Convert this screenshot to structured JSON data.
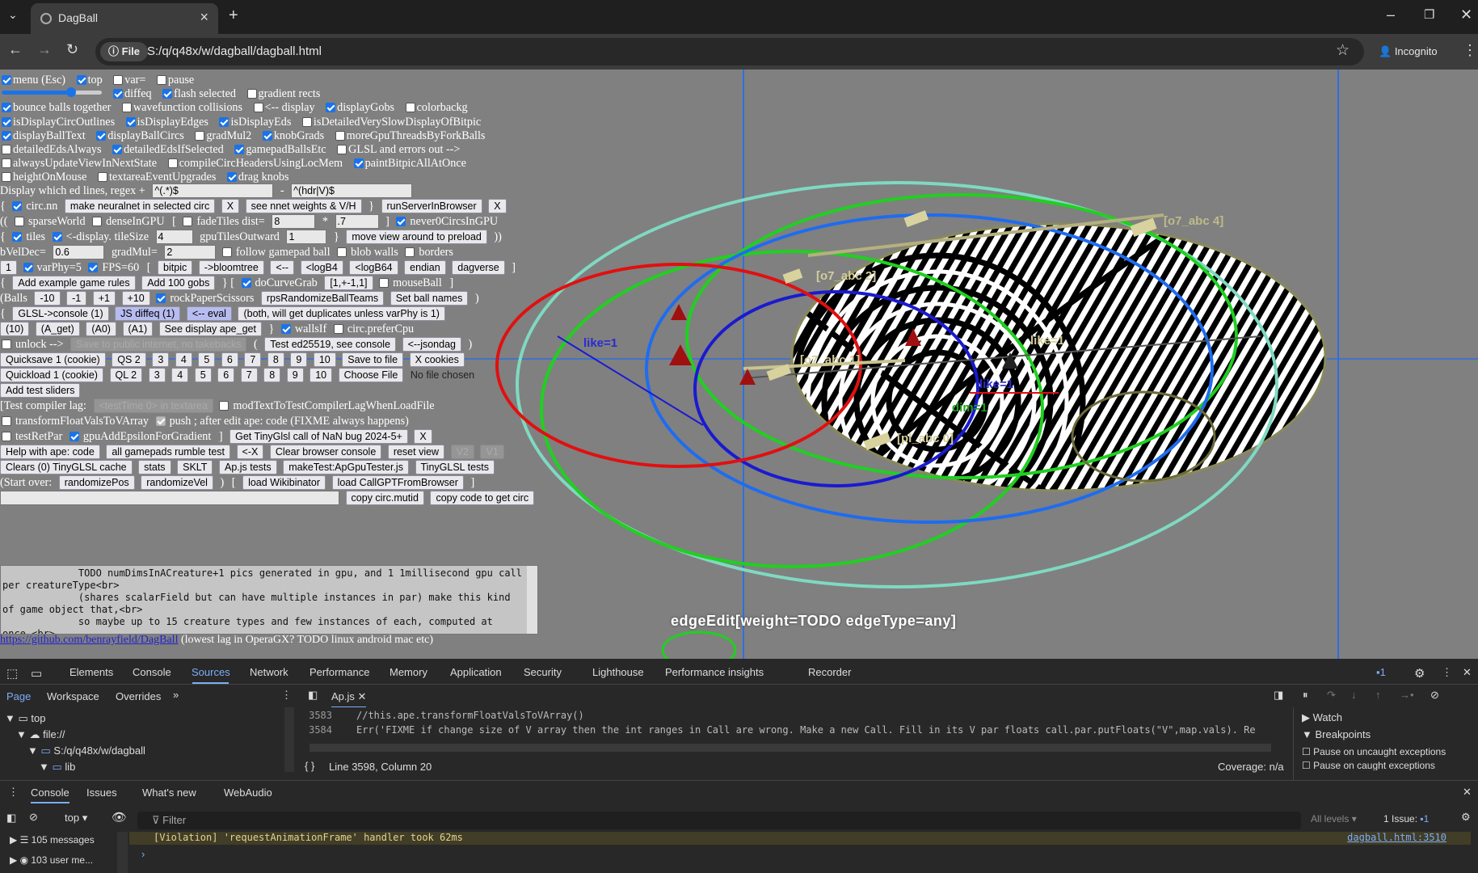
{
  "browser": {
    "tab_title": "DagBall",
    "url_chip": "File",
    "url": "S:/q/q48x/w/dagball/dagball.html",
    "incognito_label": "Incognito"
  },
  "panel": {
    "row0": {
      "menu": "menu (Esc)",
      "top": "top",
      "var": "var=",
      "pause": "pause"
    },
    "row1": {
      "diffeq": "diffeq",
      "flash": "flash selected",
      "gradient": "gradient rects"
    },
    "row2": {
      "bounce": "bounce balls together",
      "wavefn": "wavefunction collisions",
      "display": "<-- display",
      "gobs": "displayGobs",
      "colorbackg": "colorbackg"
    },
    "row3": {
      "circout": "isDisplayCircOutlines",
      "edges": "isDisplayEdges",
      "eds": "isDisplayEds",
      "detailed": "isDetailedVerySlowDisplayOfBitpic"
    },
    "row4": {
      "balltext": "displayBallText",
      "ballcircs": "displayBallCircs",
      "gradmul": "gradMul2",
      "knobgrads": "knobGrads",
      "moregpu": "moreGpuThreadsByForkBalls"
    },
    "row5": {
      "detEds": "detailedEdsAlways",
      "detEdsSel": "detailedEdsIfSelected",
      "gamepad": "gamepadBallsEtc",
      "glsl": "GLSL and errors out -->"
    },
    "row6": {
      "always": "alwaysUpdateViewInNextState",
      "compile": "compileCircHeadersUsingLocMem",
      "paint": "paintBitpicAllAtOnce"
    },
    "row7": {
      "height": "heightOnMouse",
      "textarea": "textareaEventUpgrades",
      "drag": "drag knobs"
    },
    "row8": {
      "label": "Display which ed lines, regex +",
      "regex_plus": "^(.*)$",
      "minus": "-",
      "regex_minus": "^(hdr|V)$"
    },
    "row9": {
      "open": "{",
      "circnn": "circ.nn",
      "b1": "make neuralnet in selected circ",
      "x1": "X",
      "b2": "see nnet weights & V/H",
      "close": "}",
      "b3": "runServerInBrowser",
      "x2": "X"
    },
    "row10": {
      "open": "((",
      "sparse": "sparseWorld",
      "dense": "denseInGPU",
      "bracket": "[",
      "fade": "fadeTiles dist=",
      "fade_val": "8",
      "star": "*",
      "fade_mul": ".7",
      "close": "]",
      "never0": "never0CircsInGPU"
    },
    "row11": {
      "open": "{",
      "tiles": "tiles",
      "display": "<-display. tileSize",
      "tilesize": "4",
      "outward": "gpuTilesOutward",
      "outward_val": "1",
      "close": "}",
      "move": "move view around to preload",
      "end": "))"
    },
    "row12": {
      "veldec": "bVelDec=",
      "veldec_val": "0.6",
      "gradmul": "gradMul=",
      "gradmul_val": "2",
      "follow": "follow gamepad ball",
      "blob": "blob walls",
      "borders": "borders"
    },
    "row13": {
      "one": "1",
      "varphy": "varPhy=5",
      "fps": "FPS=60",
      "bracket": "[",
      "bitpic": "bitpic",
      "bloom": "->bloomtree",
      "back": "<--",
      "logb4": "<logB4",
      "logb64": "<logB64",
      "endian": "endian",
      "dagverse": "dagverse",
      "close": "]"
    },
    "row14": {
      "open": "{",
      "addex": "Add example game rules",
      "add100": "Add 100 gobs",
      "mid": "} [",
      "curve": "doCurveGrab",
      "curve_btn": "[1,+-1,1]",
      "mouse": "mouseBall",
      "close": "]"
    },
    "row15": {
      "balls": "(Balls",
      "m10": "-10",
      "m1": "-1",
      "p1": "+1",
      "p10": "+10",
      "rps": "rockPaperScissors",
      "rpsbtn": "rpsRandomizeBallTeams",
      "names": "Set ball names",
      "close": ")"
    },
    "row16": {
      "open": "{",
      "glsl": "GLSL->console (1)",
      "js": "JS diffeq (1)",
      "eval": "<-- eval",
      "both": "(both, will get duplicates unless varPhy is 1)"
    },
    "row17": {
      "b10": "(10)",
      "aget": "(A_get)",
      "a0": "(A0)",
      "a1": "(A1)",
      "seeape": "See display ape_get",
      "close": "}",
      "walls": "wallsIf",
      "prefer": "circ.preferCpu"
    },
    "row18": {
      "unlock": "unlock -->",
      "save": "Save to public internet, no takebacks",
      "open": "(",
      "test": "Test ed25519, see console",
      "json": "<--jsondag",
      "close": ")"
    },
    "row19": {
      "qs1": "Quicksave 1 (cookie)",
      "qs2": "QS 2",
      "n": [
        "3",
        "4",
        "5",
        "6",
        "7",
        "8",
        "9",
        "10"
      ],
      "savefile": "Save to file",
      "xcookies": "X cookies"
    },
    "row20": {
      "ql1": "Quickload 1 (cookie)",
      "ql2": "QL 2",
      "n": [
        "3",
        "4",
        "5",
        "6",
        "7",
        "8",
        "9",
        "10"
      ],
      "choose": "Choose File",
      "nofile": "No file chosen"
    },
    "row21": {
      "sliders": "Add test sliders"
    },
    "row22": {
      "lag": "[Test compiler lag:",
      "testtime": "<testTime 0> in textarea",
      "mod": "modTextToTestCompilerLagWhenLoadFile"
    },
    "row23": {
      "transform": "transformFloatValsToVArray",
      "push": "push ; after edit ape: code (FIXME always happens)"
    },
    "row24": {
      "testret": "testRetPar",
      "gpuadd": "gpuAddEpsilonForGradient",
      "close": "]",
      "nanbug": "Get TinyGlsl call of NaN bug 2024-5+",
      "x": "X"
    },
    "row25": {
      "help": "Help with ape: code",
      "rumble": "all gamepads rumble test",
      "lx": "<-X",
      "clear": "Clear browser console",
      "reset": "reset view",
      "v2": "V2",
      "v1": "V1"
    },
    "row26": {
      "clears": "Clears (0) TinyGLSL cache",
      "stats": "stats",
      "sklt": "SKLT",
      "apjs": "Ap.js tests",
      "maketest": "makeTest:ApGpuTester.js",
      "tinyglsl": "TinyGLSL tests"
    },
    "row27": {
      "start": "(Start over:",
      "rpos": "randomizePos",
      "rvel": "randomizeVel",
      "close": ")",
      "bracket": "[",
      "wiki": "load Wikibinator",
      "callgpt": "load CallGPTFromBrowser",
      "end": "]"
    },
    "row28": {
      "mutid": "copy circ.mutid",
      "getcirc": "copy code to get circ"
    },
    "notes": "             TODO numDimsInACreature+1 pics generated in gpu, and 1 1millisecond gpu call per creatureType<br>\n             (shares scalarField but can have multiple instances in par) make this kind of game object that,<br>\n             so maybe up to 15 creature types and few instances of each, computed at once.<br>\n             interacts mostly with eachother and turn off the other object types with",
    "footer_link": "https://github.com/benrayfield/DagBall",
    "footer_text": "(lowest lag in OperaGX? TODO linux android mac etc)"
  },
  "canvas": {
    "labels": [
      "like=1",
      "[o7_abc 2]",
      "[o7_abc 1]",
      "[pl_abc 0]",
      "like=1",
      "like=1",
      "dim=1",
      "[o7_abc 4]"
    ],
    "edge_edit": "edgeEdit[weight=TODO edgeType=any]"
  },
  "devtools": {
    "tabs": [
      "Elements",
      "Console",
      "Sources",
      "Network",
      "Performance",
      "Memory",
      "Application",
      "Security",
      "Lighthouse",
      "Performance insights",
      "Recorder"
    ],
    "issues_badge": "1",
    "nav_tabs": [
      "Page",
      "Workspace",
      "Overrides"
    ],
    "tree": [
      "top",
      "file://",
      "S:/q/q48x/w/dagball",
      "lib"
    ],
    "file_tab": "Ap.js",
    "code": [
      {
        "ln": "3583",
        "text": "//this.ape.transformFloatValsToVArray()"
      },
      {
        "ln": "3584",
        "text": "Err('FIXME if change size of V array then the int ranges in Call are wrong. Make a new Call. Fill in its V par floats call.par.putFloats(\"V\",map.vals). Re"
      }
    ],
    "status": "Line 3598, Column 20",
    "coverage": "Coverage: n/a",
    "right": [
      "Watch",
      "Breakpoints",
      "Pause on uncaught exceptions",
      "Pause on caught exceptions"
    ],
    "drawer_tabs": [
      "Console",
      "Issues",
      "What's new",
      "WebAudio"
    ],
    "context": "top",
    "filter": "Filter",
    "levels": "All levels",
    "issue_count": "1 Issue:",
    "issue_n": "1",
    "violation": "[Violation] 'requestAnimationFrame' handler took 62ms",
    "violation_link": "dagball.html:3510",
    "side": [
      "105 messages",
      "103 user me..."
    ]
  }
}
